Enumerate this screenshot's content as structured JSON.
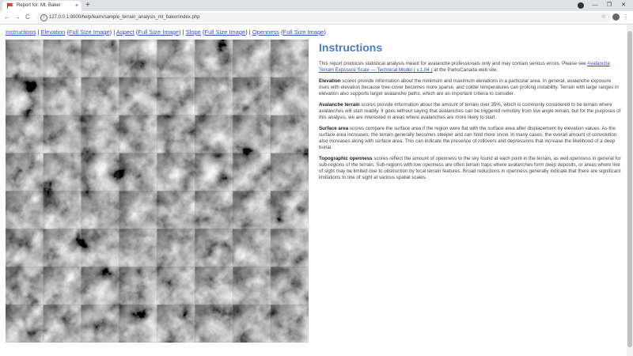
{
  "browser": {
    "tab_title": "Report for: Mt. Baker",
    "tab_close": "×",
    "new_tab": "+",
    "back": "←",
    "forward": "→",
    "reload": "C",
    "url": "127.0.0.1:8000/help/learn/sample_terrain_analysis_mt_baker/index.php",
    "info": "i",
    "star": "☆",
    "menu": "⋮",
    "minimize": "—",
    "maximize": "❐",
    "close": "✕"
  },
  "nav": {
    "instructions": "Instructions",
    "elevation": "Elevation",
    "elevation_full": "Full Size Image",
    "aspect": "Aspect",
    "aspect_full": "Full Size Image",
    "slope": "Slope",
    "slope_full": "Full Size Image",
    "openness": "Openness",
    "openness_full": "Full Size Image",
    "sep": "|"
  },
  "content": {
    "title": "Instructions",
    "intro_before": "This report produces statistical analysis meant for avalanche professionals only and may contain serious errors. Please see",
    "intro_link": "Avalanche Terrain Exposure Scale — Technical Model ( v.1.04 )",
    "intro_after": "at the ParksCanada web site.",
    "elevation_term": "Elevation",
    "elevation_text": "scores provide information about the minimum and maximum elevations in a particular area. In general, avalanche exposure rises with elevation because tree-cover becomes more sparse, and colder temperatures can prolong instability. Terrain with large ranges in elevation also supports larger avalanche paths, which are an important criteria to consider.",
    "avalanche_term": "Avalanche terrain",
    "avalanche_text": "scores provide information about the amount of terrain over 35%, which is commonly considered to be terrain where avalanches will start readily. It goes without saying that avalanches can be triggered remotely from low angle terrain, but for the purposes of this analysis, we are interested in areas where avalanches are more likely to start.",
    "surface_term": "Surface area",
    "surface_text": "scores compare the surface area if the region were flat with the surface area after displacement by elevation values. As the surface area increases, the terrain generally becomes steeper and can hold more snow. In many cases, the overall amount of convolution also increases along with surface area. This can indicate the presence of rollovers and depressions that increase the likelihood of a deep burial.",
    "openness_term": "Topographic openness",
    "openness_text": "scores reflect the amount of openness to the sky found at each point in the terrain, as well openness in general for sub-regions of the terrain. Sub-regions with low openness are often terrain traps where avalanches form deep deposits, or areas where line of sight may be limited due to obstruction by local terrain features. Broad reductions in openness generally indicate that there are significant limitations to line of sight at various spatial scales."
  },
  "colors": {
    "heading": "#4a7bbf",
    "link": "#2f4fc0",
    "chrome": "#dee1e6"
  }
}
